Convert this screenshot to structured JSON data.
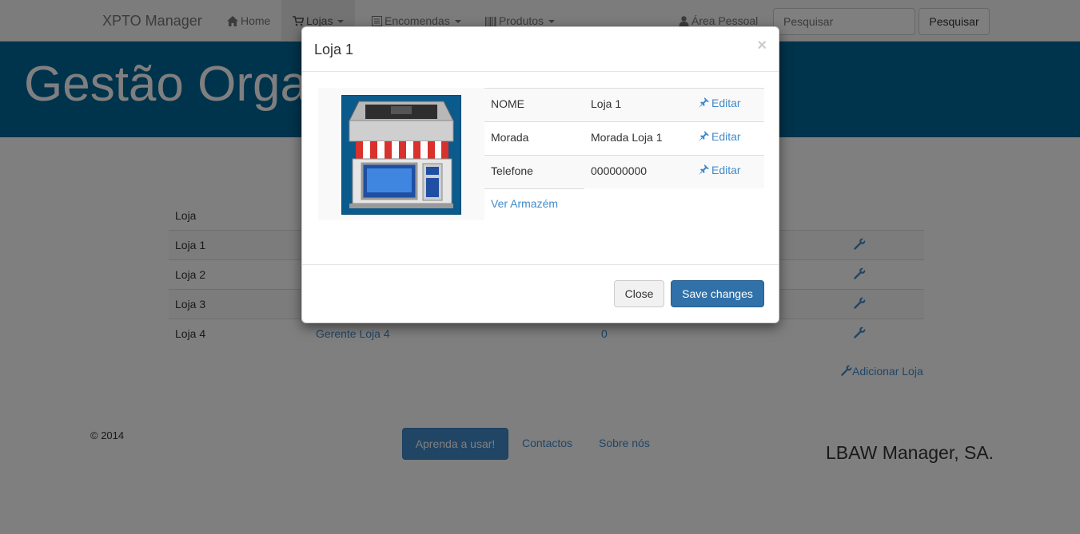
{
  "navbar": {
    "brand": "XPTO Manager",
    "items": [
      {
        "label": "Home",
        "icon": "home-icon"
      },
      {
        "label": "Lojas",
        "icon": "cart-icon"
      },
      {
        "label": "Encomendas",
        "icon": "list-icon"
      },
      {
        "label": "Produtos",
        "icon": "barcode-icon"
      },
      {
        "label": "Área Pessoal",
        "icon": "user-icon"
      }
    ],
    "search_placeholder": "Pesquisar",
    "search_button": "Pesquisar"
  },
  "hero": {
    "title": "Gestão Organizada e Rápida"
  },
  "table": {
    "header": "Loja",
    "rows": [
      {
        "loja": "Loja 1",
        "gerente": "",
        "num": ""
      },
      {
        "loja": "Loja 2",
        "gerente": "",
        "num": ""
      },
      {
        "loja": "Loja 3",
        "gerente": "",
        "num": ""
      },
      {
        "loja": "Loja 4",
        "gerente": "Gerente Loja 4",
        "num": "0"
      }
    ],
    "add_label": "Adicionar Loja"
  },
  "footer": {
    "copyright": "© 2014",
    "learn_button": "Aprenda a usar!",
    "links": [
      "Contactos",
      "Sobre nós"
    ],
    "company": "LBAW Manager, SA."
  },
  "modal": {
    "title": "Loja 1",
    "close_symbol": "×",
    "rows": [
      {
        "key": "NOME",
        "value": "Loja 1",
        "edit": "Editar"
      },
      {
        "key": "Morada",
        "value": "Morada Loja 1",
        "edit": "Editar"
      },
      {
        "key": "Telefone",
        "value": "000000000",
        "edit": "Editar"
      }
    ],
    "warehouse_link": "Ver Armazém",
    "close_button": "Close",
    "save_button": "Save changes"
  },
  "colors": {
    "brand_blue": "#006699",
    "link": "#428bca",
    "primary": "#3071a9"
  }
}
